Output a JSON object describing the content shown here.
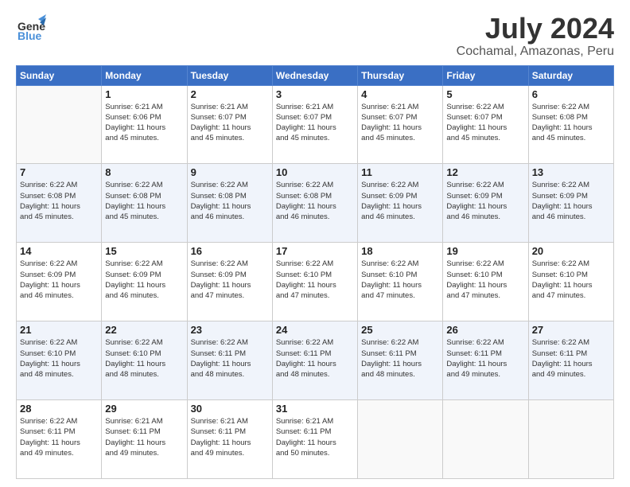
{
  "header": {
    "logo_line1": "General",
    "logo_line2": "Blue",
    "title": "July 2024",
    "subtitle": "Cochamal, Amazonas, Peru"
  },
  "weekdays": [
    "Sunday",
    "Monday",
    "Tuesday",
    "Wednesday",
    "Thursday",
    "Friday",
    "Saturday"
  ],
  "weeks": [
    [
      {
        "day": "",
        "info": ""
      },
      {
        "day": "1",
        "info": "Sunrise: 6:21 AM\nSunset: 6:06 PM\nDaylight: 11 hours\nand 45 minutes."
      },
      {
        "day": "2",
        "info": "Sunrise: 6:21 AM\nSunset: 6:07 PM\nDaylight: 11 hours\nand 45 minutes."
      },
      {
        "day": "3",
        "info": "Sunrise: 6:21 AM\nSunset: 6:07 PM\nDaylight: 11 hours\nand 45 minutes."
      },
      {
        "day": "4",
        "info": "Sunrise: 6:21 AM\nSunset: 6:07 PM\nDaylight: 11 hours\nand 45 minutes."
      },
      {
        "day": "5",
        "info": "Sunrise: 6:22 AM\nSunset: 6:07 PM\nDaylight: 11 hours\nand 45 minutes."
      },
      {
        "day": "6",
        "info": "Sunrise: 6:22 AM\nSunset: 6:08 PM\nDaylight: 11 hours\nand 45 minutes."
      }
    ],
    [
      {
        "day": "7",
        "info": "Sunrise: 6:22 AM\nSunset: 6:08 PM\nDaylight: 11 hours\nand 45 minutes."
      },
      {
        "day": "8",
        "info": "Sunrise: 6:22 AM\nSunset: 6:08 PM\nDaylight: 11 hours\nand 45 minutes."
      },
      {
        "day": "9",
        "info": "Sunrise: 6:22 AM\nSunset: 6:08 PM\nDaylight: 11 hours\nand 46 minutes."
      },
      {
        "day": "10",
        "info": "Sunrise: 6:22 AM\nSunset: 6:08 PM\nDaylight: 11 hours\nand 46 minutes."
      },
      {
        "day": "11",
        "info": "Sunrise: 6:22 AM\nSunset: 6:09 PM\nDaylight: 11 hours\nand 46 minutes."
      },
      {
        "day": "12",
        "info": "Sunrise: 6:22 AM\nSunset: 6:09 PM\nDaylight: 11 hours\nand 46 minutes."
      },
      {
        "day": "13",
        "info": "Sunrise: 6:22 AM\nSunset: 6:09 PM\nDaylight: 11 hours\nand 46 minutes."
      }
    ],
    [
      {
        "day": "14",
        "info": "Sunrise: 6:22 AM\nSunset: 6:09 PM\nDaylight: 11 hours\nand 46 minutes."
      },
      {
        "day": "15",
        "info": "Sunrise: 6:22 AM\nSunset: 6:09 PM\nDaylight: 11 hours\nand 46 minutes."
      },
      {
        "day": "16",
        "info": "Sunrise: 6:22 AM\nSunset: 6:09 PM\nDaylight: 11 hours\nand 47 minutes."
      },
      {
        "day": "17",
        "info": "Sunrise: 6:22 AM\nSunset: 6:10 PM\nDaylight: 11 hours\nand 47 minutes."
      },
      {
        "day": "18",
        "info": "Sunrise: 6:22 AM\nSunset: 6:10 PM\nDaylight: 11 hours\nand 47 minutes."
      },
      {
        "day": "19",
        "info": "Sunrise: 6:22 AM\nSunset: 6:10 PM\nDaylight: 11 hours\nand 47 minutes."
      },
      {
        "day": "20",
        "info": "Sunrise: 6:22 AM\nSunset: 6:10 PM\nDaylight: 11 hours\nand 47 minutes."
      }
    ],
    [
      {
        "day": "21",
        "info": "Sunrise: 6:22 AM\nSunset: 6:10 PM\nDaylight: 11 hours\nand 48 minutes."
      },
      {
        "day": "22",
        "info": "Sunrise: 6:22 AM\nSunset: 6:10 PM\nDaylight: 11 hours\nand 48 minutes."
      },
      {
        "day": "23",
        "info": "Sunrise: 6:22 AM\nSunset: 6:11 PM\nDaylight: 11 hours\nand 48 minutes."
      },
      {
        "day": "24",
        "info": "Sunrise: 6:22 AM\nSunset: 6:11 PM\nDaylight: 11 hours\nand 48 minutes."
      },
      {
        "day": "25",
        "info": "Sunrise: 6:22 AM\nSunset: 6:11 PM\nDaylight: 11 hours\nand 48 minutes."
      },
      {
        "day": "26",
        "info": "Sunrise: 6:22 AM\nSunset: 6:11 PM\nDaylight: 11 hours\nand 49 minutes."
      },
      {
        "day": "27",
        "info": "Sunrise: 6:22 AM\nSunset: 6:11 PM\nDaylight: 11 hours\nand 49 minutes."
      }
    ],
    [
      {
        "day": "28",
        "info": "Sunrise: 6:22 AM\nSunset: 6:11 PM\nDaylight: 11 hours\nand 49 minutes."
      },
      {
        "day": "29",
        "info": "Sunrise: 6:21 AM\nSunset: 6:11 PM\nDaylight: 11 hours\nand 49 minutes."
      },
      {
        "day": "30",
        "info": "Sunrise: 6:21 AM\nSunset: 6:11 PM\nDaylight: 11 hours\nand 49 minutes."
      },
      {
        "day": "31",
        "info": "Sunrise: 6:21 AM\nSunset: 6:11 PM\nDaylight: 11 hours\nand 50 minutes."
      },
      {
        "day": "",
        "info": ""
      },
      {
        "day": "",
        "info": ""
      },
      {
        "day": "",
        "info": ""
      }
    ]
  ]
}
